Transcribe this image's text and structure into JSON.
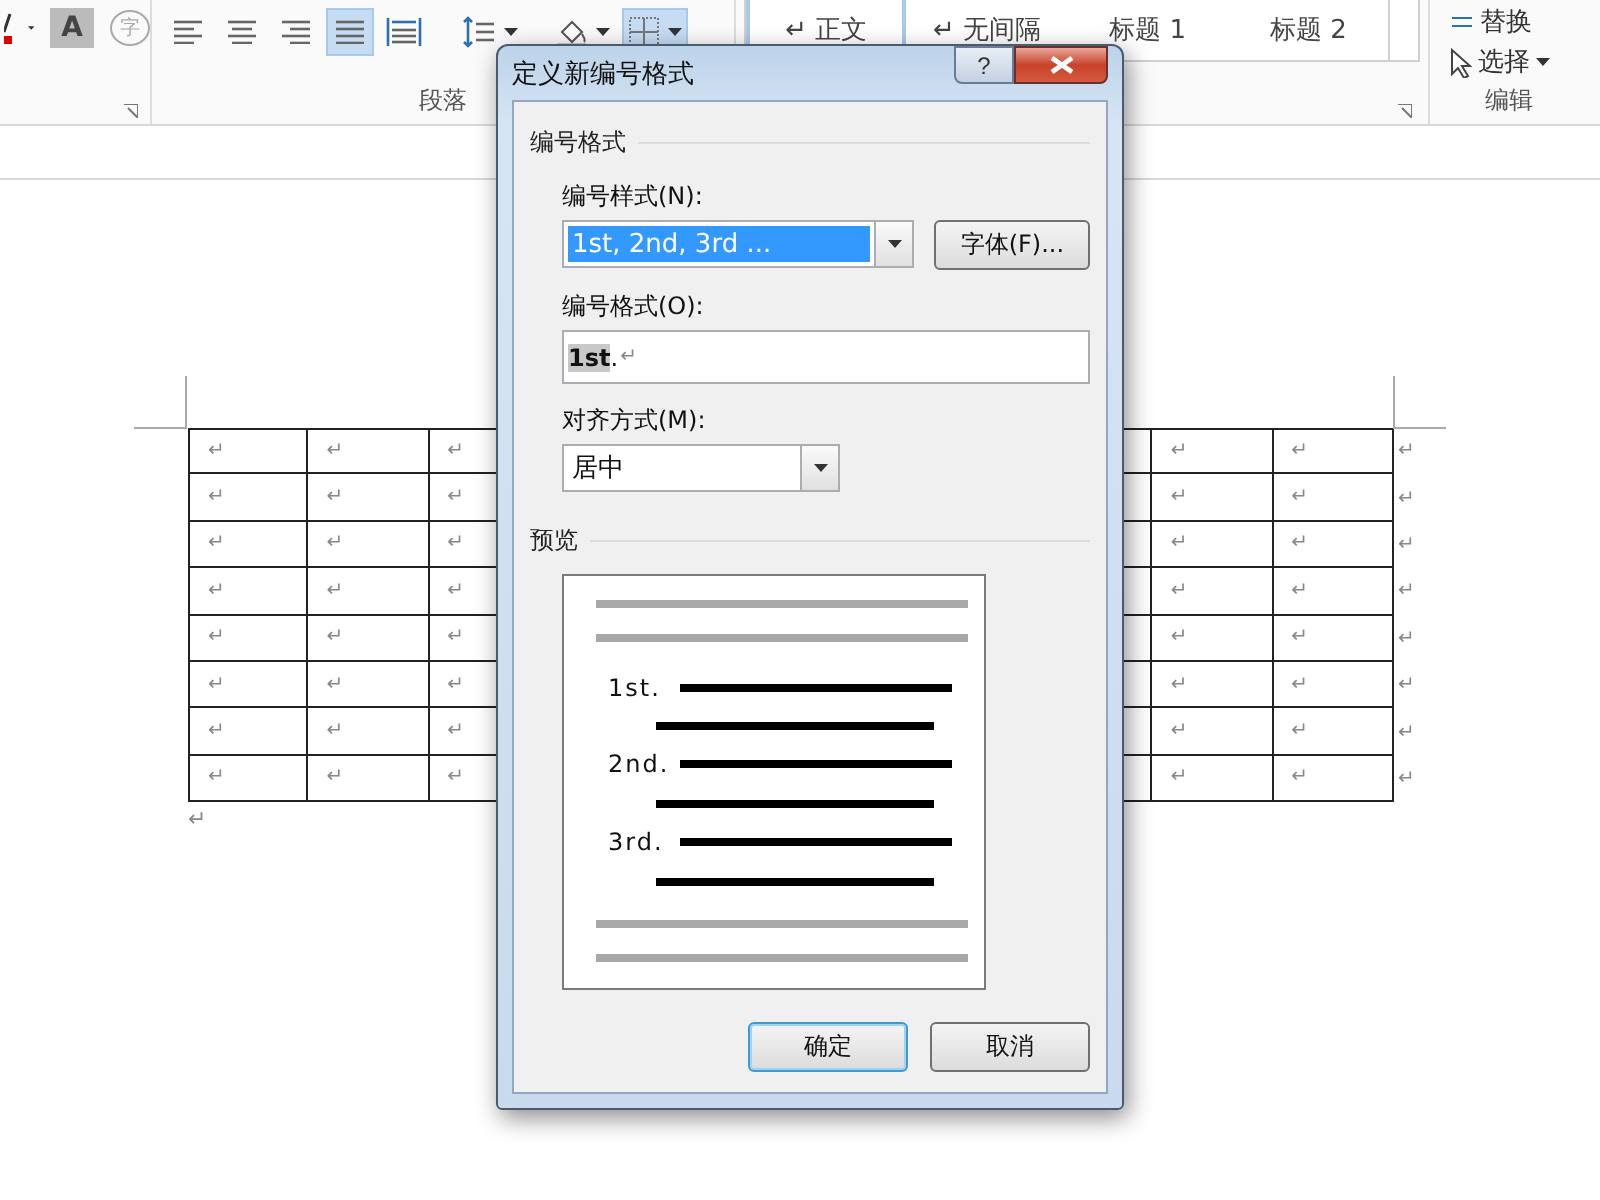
{
  "ribbon": {
    "font_buttons": [
      {
        "kind": "font-color"
      },
      {
        "kind": "caret"
      },
      {
        "kind": "shading",
        "glyph": "A"
      },
      {
        "kind": "enclose",
        "glyph": "字"
      }
    ],
    "paragraph_buttons": [
      {
        "kind": "align-left",
        "selected": false
      },
      {
        "kind": "align-center",
        "selected": false
      },
      {
        "kind": "align-right",
        "selected": false
      },
      {
        "kind": "justify",
        "selected": true
      },
      {
        "kind": "distribute",
        "selected": false
      },
      {
        "kind": "line-spacing",
        "selected": false
      },
      {
        "kind": "shading",
        "selected": false
      },
      {
        "kind": "borders",
        "selected": true
      }
    ],
    "paragraph_label": "段落",
    "styles": [
      {
        "label": "正文",
        "mark": "↵",
        "selected": true
      },
      {
        "label": "无间隔",
        "mark": "↵",
        "selected": false
      },
      {
        "label": "标题 1",
        "selected": false
      },
      {
        "label": "标题 2",
        "selected": false
      }
    ],
    "editing": {
      "replace": "替换",
      "select": "选择",
      "label": "编辑"
    }
  },
  "document": {
    "rows": [
      {
        "left_cells": [
          "↵",
          "↵",
          "↵"
        ],
        "right_cells": [
          "↵",
          "↵"
        ],
        "end_mark": "↵"
      },
      {
        "left_cells": [
          "↵",
          "↵",
          "↵"
        ],
        "right_cells": [
          "↵",
          "↵"
        ],
        "end_mark": "↵"
      },
      {
        "left_cells": [
          "↵",
          "↵",
          "↵"
        ],
        "right_cells": [
          "↵",
          "↵"
        ],
        "end_mark": "↵"
      },
      {
        "left_cells": [
          "↵",
          "↵",
          "↵"
        ],
        "right_cells": [
          "↵",
          "↵"
        ],
        "end_mark": "↵"
      },
      {
        "left_cells": [
          "↵",
          "↵",
          "↵"
        ],
        "right_cells": [
          "↵",
          "↵"
        ],
        "end_mark": "↵"
      },
      {
        "left_cells": [
          "↵",
          "↵",
          "↵"
        ],
        "right_cells": [
          "↵",
          "↵"
        ],
        "end_mark": "↵"
      },
      {
        "left_cells": [
          "↵",
          "↵",
          "↵"
        ],
        "right_cells": [
          "↵",
          "↵"
        ],
        "end_mark": "↵"
      },
      {
        "left_cells": [
          "↵",
          "↵",
          "↵"
        ],
        "right_cells": [
          "↵",
          "↵"
        ],
        "end_mark": "↵"
      }
    ],
    "paragraph_mark": "↵"
  },
  "dialog": {
    "title": "定义新编号格式",
    "help": "?",
    "group_label": "编号格式",
    "style_label": "编号样式(N):",
    "style_value": "1st, 2nd, 3rd ...",
    "font_button": "字体(F)...",
    "format_label": "编号格式(O):",
    "format_number": "1st",
    "format_suffix": ".",
    "format_mark": "↵",
    "align_label": "对齐方式(M):",
    "align_value": "居中",
    "preview_label": "预览",
    "preview_items": [
      "1st.",
      "2nd.",
      "3rd."
    ],
    "buttons": [
      {
        "label": "确定",
        "default": true
      },
      {
        "label": "取消",
        "default": false
      }
    ]
  }
}
